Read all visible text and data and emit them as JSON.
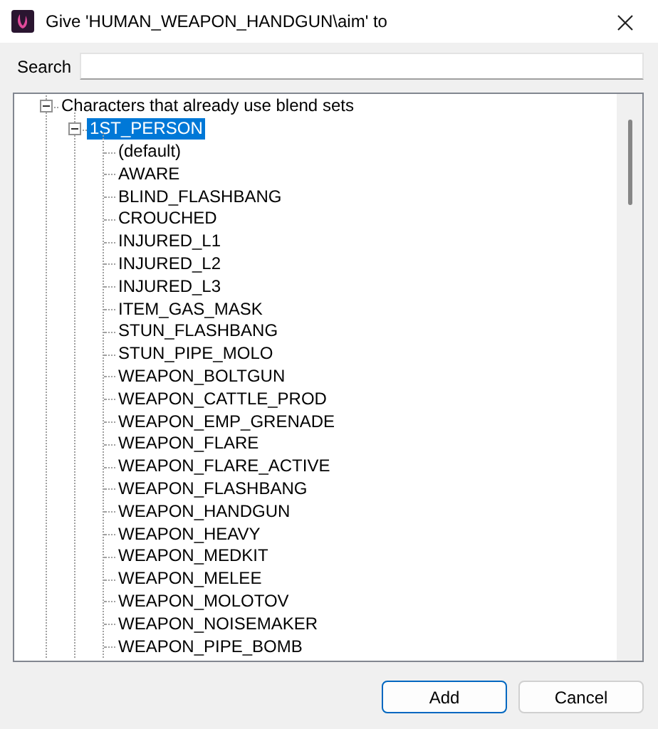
{
  "window": {
    "title": "Give 'HUMAN_WEAPON_HANDGUN\\aim' to"
  },
  "search": {
    "label": "Search"
  },
  "tree": [
    {
      "label": "Characters that already use blend sets",
      "expanded": true,
      "selected": false,
      "children": [
        {
          "label": "1ST_PERSON",
          "expanded": true,
          "selected": true,
          "children": [
            {
              "label": "(default)",
              "selected": false
            },
            {
              "label": "AWARE",
              "selected": false
            },
            {
              "label": "BLIND_FLASHBANG",
              "selected": false
            },
            {
              "label": "CROUCHED",
              "selected": false
            },
            {
              "label": "INJURED_L1",
              "selected": false
            },
            {
              "label": "INJURED_L2",
              "selected": false
            },
            {
              "label": "INJURED_L3",
              "selected": false
            },
            {
              "label": "ITEM_GAS_MASK",
              "selected": false
            },
            {
              "label": "STUN_FLASHBANG",
              "selected": false
            },
            {
              "label": "STUN_PIPE_MOLO",
              "selected": false
            },
            {
              "label": "WEAPON_BOLTGUN",
              "selected": false
            },
            {
              "label": "WEAPON_CATTLE_PROD",
              "selected": false
            },
            {
              "label": "WEAPON_EMP_GRENADE",
              "selected": false
            },
            {
              "label": "WEAPON_FLARE",
              "selected": false
            },
            {
              "label": "WEAPON_FLARE_ACTIVE",
              "selected": false
            },
            {
              "label": "WEAPON_FLASHBANG",
              "selected": false
            },
            {
              "label": "WEAPON_HANDGUN",
              "selected": false
            },
            {
              "label": "WEAPON_HEAVY",
              "selected": false
            },
            {
              "label": "WEAPON_MEDKIT",
              "selected": false
            },
            {
              "label": "WEAPON_MELEE",
              "selected": false
            },
            {
              "label": "WEAPON_MOLOTOV",
              "selected": false
            },
            {
              "label": "WEAPON_NOISEMAKER",
              "selected": false
            },
            {
              "label": "WEAPON_PIPE_BOMB",
              "selected": false
            }
          ]
        }
      ]
    }
  ],
  "buttons": [
    {
      "label": "Add",
      "default": true
    },
    {
      "label": "Cancel",
      "default": false
    }
  ]
}
